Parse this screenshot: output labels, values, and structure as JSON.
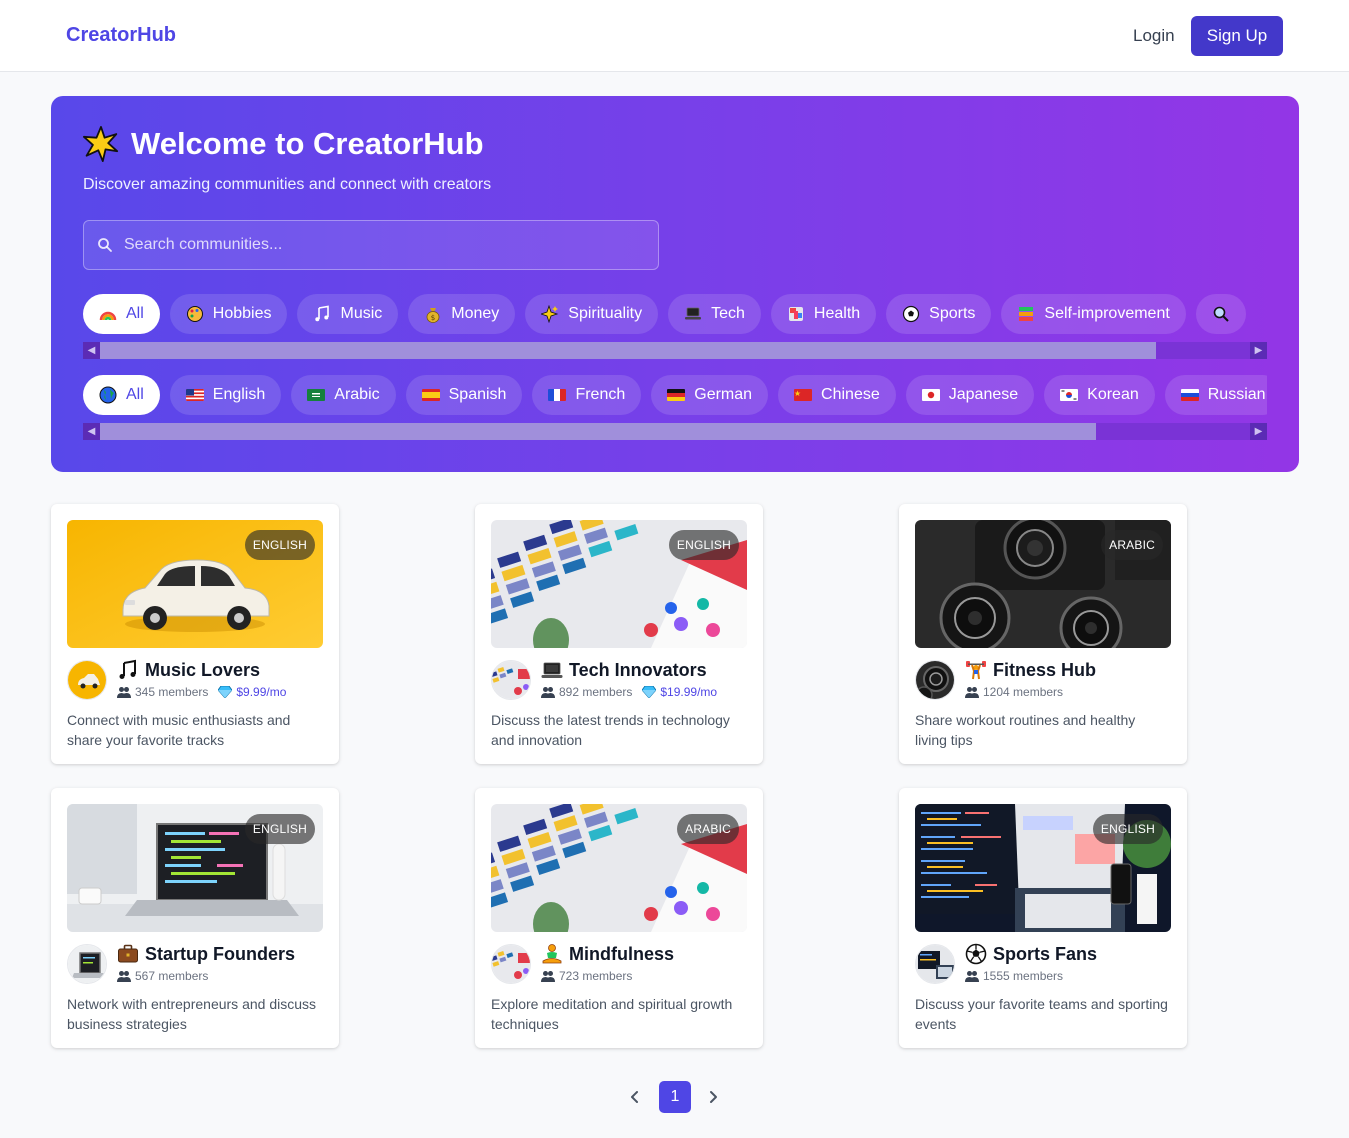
{
  "header": {
    "logo": "CreatorHub",
    "login": "Login",
    "signup": "Sign Up"
  },
  "hero": {
    "title": "Welcome to CreatorHub",
    "subtitle": "Discover amazing communities and connect with creators",
    "search_placeholder": "Search communities..."
  },
  "categories": [
    {
      "label": "All",
      "icon": "rainbow-icon",
      "active": true
    },
    {
      "label": "Hobbies",
      "icon": "palette-icon"
    },
    {
      "label": "Music",
      "icon": "music-note-icon"
    },
    {
      "label": "Money",
      "icon": "money-bag-icon"
    },
    {
      "label": "Spirituality",
      "icon": "sparkles-icon"
    },
    {
      "label": "Tech",
      "icon": "laptop-icon"
    },
    {
      "label": "Health",
      "icon": "health-icon"
    },
    {
      "label": "Sports",
      "icon": "soccer-ball-icon"
    },
    {
      "label": "Self-improvement",
      "icon": "books-icon"
    }
  ],
  "languages": [
    {
      "label": "All",
      "icon": "globe-icon",
      "active": true
    },
    {
      "label": "English",
      "icon": "us-flag-icon"
    },
    {
      "label": "Arabic",
      "icon": "saudi-flag-icon"
    },
    {
      "label": "Spanish",
      "icon": "spain-flag-icon"
    },
    {
      "label": "French",
      "icon": "france-flag-icon"
    },
    {
      "label": "German",
      "icon": "germany-flag-icon"
    },
    {
      "label": "Chinese",
      "icon": "china-flag-icon"
    },
    {
      "label": "Japanese",
      "icon": "japan-flag-icon"
    },
    {
      "label": "Korean",
      "icon": "korea-flag-icon"
    },
    {
      "label": "Russian",
      "icon": "russia-flag-icon"
    }
  ],
  "scrollbars": {
    "categories_visible_fraction": 0.94,
    "languages_visible_fraction": 0.88
  },
  "communities": [
    {
      "name": "Music Lovers",
      "icon": "music-note-icon",
      "language": "ENGLISH",
      "members": "345 members",
      "price": "$9.99/mo",
      "description": "Connect with music enthusiasts and share your favorite tracks",
      "image": "toy-car-image"
    },
    {
      "name": "Tech Innovators",
      "icon": "laptop-icon",
      "language": "ENGLISH",
      "members": "892 members",
      "price": "$19.99/mo",
      "description": "Discuss the latest trends in technology and innovation",
      "image": "color-swatches-image"
    },
    {
      "name": "Fitness Hub",
      "icon": "weightlifter-icon",
      "language": "ARABIC",
      "members": "1204 members",
      "price": "",
      "description": "Share workout routines and healthy living tips",
      "image": "camera-lenses-image"
    },
    {
      "name": "Startup Founders",
      "icon": "briefcase-icon",
      "language": "ENGLISH",
      "members": "567 members",
      "price": "",
      "description": "Network with entrepreneurs and discuss business strategies",
      "image": "laptop-desk-image"
    },
    {
      "name": "Mindfulness",
      "icon": "meditation-icon",
      "language": "ARABIC",
      "members": "723 members",
      "price": "",
      "description": "Explore meditation and spiritual growth techniques",
      "image": "color-swatches-image"
    },
    {
      "name": "Sports Fans",
      "icon": "soccer-ball-icon",
      "language": "ENGLISH",
      "members": "1555 members",
      "price": "",
      "description": "Discuss your favorite teams and sporting events",
      "image": "code-screens-image"
    }
  ],
  "pagination": {
    "prev": "‹",
    "current": "1",
    "next": "›"
  },
  "colors": {
    "brand": "#4f46e5",
    "signup": "#4338ca",
    "hero_start": "#5848ea",
    "hero_end": "#9336e6"
  }
}
